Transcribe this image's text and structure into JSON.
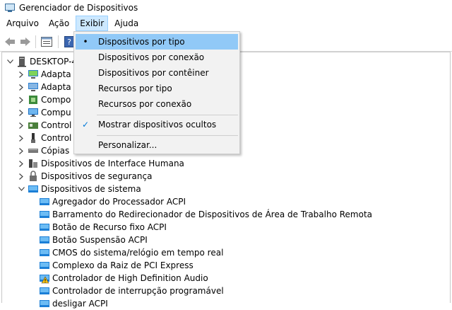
{
  "window": {
    "title": "Gerenciador de Dispositivos"
  },
  "menu": {
    "items": [
      "Arquivo",
      "Ação",
      "Exibir",
      "Ajuda"
    ]
  },
  "toolbar": {
    "icons": [
      "back-arrow-icon",
      "forward-arrow-icon",
      "properties-icon",
      "help-icon"
    ]
  },
  "tree": {
    "root": "DESKTOP-4",
    "categories": [
      "Adapta",
      "Adapta",
      "Compo",
      "Compu",
      "Control",
      "Control",
      "Cópias"
    ],
    "full_categories": [
      "Dispositivos de Interface Humana",
      "Dispositivos de segurança",
      "Dispositivos de sistema"
    ],
    "system_devices": [
      "Agregador do Processador ACPI",
      "Barramento do Redirecionador de Dispositivos de Área de Trabalho Remota",
      "Botão de Recurso fixo ACPI",
      "Botão Suspensão ACPI",
      "CMOS do sistema/relógio em tempo real",
      "Complexo da Raiz de PCI Express",
      "Controlador de High Definition Audio",
      "Controlador de interrupção programável",
      "desligar ACPI"
    ]
  },
  "dropdown": {
    "items": [
      {
        "label": "Dispositivos por tipo",
        "mark": "•"
      },
      {
        "label": "Dispositivos por conexão",
        "mark": ""
      },
      {
        "label": "Dispositivos por contêiner",
        "mark": ""
      },
      {
        "label": "Recursos por tipo",
        "mark": ""
      },
      {
        "label": "Recursos por conexão",
        "mark": ""
      },
      {
        "label": "Mostrar dispositivos ocultos",
        "mark": "✓"
      },
      {
        "label": "Personalizar...",
        "mark": ""
      }
    ]
  },
  "colors": {
    "menu_active": "#cce8ff",
    "dropdown_hover": "#91c9f7",
    "accent": "#0078d7"
  }
}
